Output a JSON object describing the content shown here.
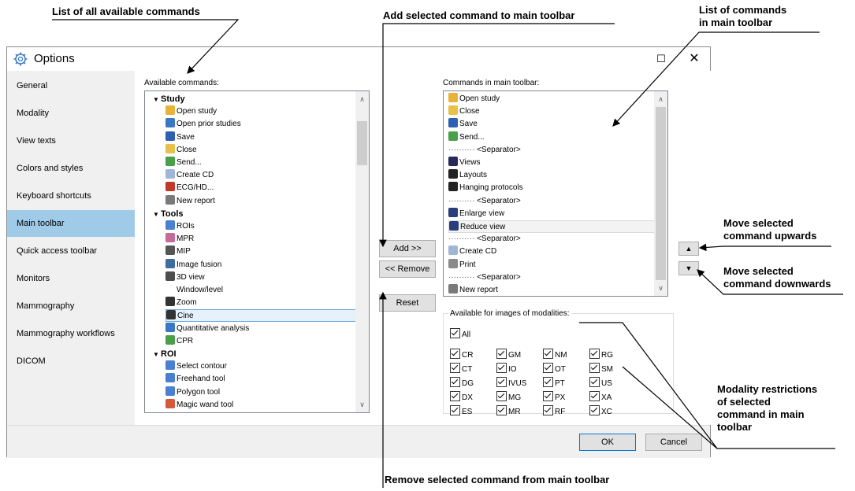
{
  "annotations": {
    "all_commands": "List of all available commands",
    "add_selected": "Add selected command to main toolbar",
    "list_main": "List of commands\nin main toolbar",
    "move_up": "Move selected\ncommand upwards",
    "move_down": "Move selected\ncommand downwards",
    "modality": "Modality restrictions\nof selected\ncommand in main\ntoolbar",
    "remove_selected": "Remove selected command from main toolbar"
  },
  "dialog": {
    "title": "Options",
    "maximize": "☐",
    "close": "✕"
  },
  "sidebar": {
    "items": [
      {
        "label": "General"
      },
      {
        "label": "Modality"
      },
      {
        "label": "View texts"
      },
      {
        "label": "Colors and styles"
      },
      {
        "label": "Keyboard shortcuts"
      },
      {
        "label": "Main toolbar",
        "selected": true
      },
      {
        "label": "Quick access toolbar"
      },
      {
        "label": "Monitors"
      },
      {
        "label": "Mammography"
      },
      {
        "label": "Mammography workflows"
      },
      {
        "label": "DICOM"
      }
    ]
  },
  "available": {
    "label": "Available commands:",
    "rows": [
      {
        "text": "Study",
        "group": true
      },
      {
        "text": "Open study",
        "icon": "folder-open-icon",
        "color": "#e8b33a"
      },
      {
        "text": "Open prior studies",
        "icon": "prior-studies-icon",
        "color": "#3b78c4"
      },
      {
        "text": "Save",
        "icon": "save-icon",
        "color": "#2f5fb3"
      },
      {
        "text": "Close",
        "icon": "folder-icon",
        "color": "#e8c04a"
      },
      {
        "text": "Send...",
        "icon": "send-icon",
        "color": "#4aa04a"
      },
      {
        "text": "Create CD",
        "icon": "cd-icon",
        "color": "#9fb6d6"
      },
      {
        "text": "ECG/HD...",
        "icon": "ecg-icon",
        "color": "#c0392b"
      },
      {
        "text": "New report",
        "icon": "report-icon",
        "color": "#7a7a7a"
      },
      {
        "text": "Tools",
        "group": true
      },
      {
        "text": "ROIs",
        "icon": "roi-icon",
        "color": "#4a7fd1"
      },
      {
        "text": "MPR",
        "icon": "mpr-icon",
        "color": "#c46b9a"
      },
      {
        "text": "MIP",
        "icon": "mip-icon",
        "color": "#555555"
      },
      {
        "text": "Image fusion",
        "icon": "fusion-icon",
        "color": "#3d6e9e"
      },
      {
        "text": "3D view",
        "icon": "cube-icon",
        "color": "#4d4d4d"
      },
      {
        "text": "Window/level",
        "icon": "",
        "color": ""
      },
      {
        "text": "Zoom",
        "icon": "magnifier-icon",
        "color": "#333333"
      },
      {
        "text": "Cine",
        "icon": "cine-icon",
        "color": "#333333",
        "selected": true
      },
      {
        "text": "Quantitative analysis",
        "icon": "chart-icon",
        "color": "#3b78c4"
      },
      {
        "text": "CPR",
        "icon": "cpr-icon",
        "color": "#4aa04a"
      },
      {
        "text": "ROI",
        "group": true
      },
      {
        "text": "Select contour",
        "icon": "select-contour-icon",
        "color": "#4a7fd1"
      },
      {
        "text": "Freehand tool",
        "icon": "freehand-icon",
        "color": "#4a7fd1"
      },
      {
        "text": "Polygon tool",
        "icon": "polygon-icon",
        "color": "#4a7fd1"
      },
      {
        "text": "Magic wand tool",
        "icon": "magic-wand-icon",
        "color": "#d65a3a"
      }
    ]
  },
  "main_toolbar": {
    "label": "Commands in main toolbar:",
    "rows": [
      {
        "text": "Open study",
        "icon": "folder-open-icon",
        "color": "#e8b33a"
      },
      {
        "text": "Close",
        "icon": "folder-icon",
        "color": "#e8c04a"
      },
      {
        "text": "Save",
        "icon": "save-icon",
        "color": "#2f5fb3"
      },
      {
        "text": "Send...",
        "icon": "send-icon",
        "color": "#4aa04a"
      },
      {
        "text": "<Separator>",
        "separator": true
      },
      {
        "text": "Views",
        "icon": "views-icon",
        "color": "#2a2a5a"
      },
      {
        "text": "Layouts",
        "icon": "layouts-icon",
        "color": "#222222"
      },
      {
        "text": "Hanging protocols",
        "icon": "hanging-protocols-icon",
        "color": "#222222"
      },
      {
        "text": "<Separator>",
        "separator": true
      },
      {
        "text": "Enlarge view",
        "icon": "enlarge-view-icon",
        "color": "#2a3f7a"
      },
      {
        "text": "Reduce view",
        "icon": "reduce-view-icon",
        "color": "#2a3f7a",
        "highlight": true
      },
      {
        "text": "<Separator>",
        "separator": true
      },
      {
        "text": "Create CD",
        "icon": "cd-icon",
        "color": "#9fb6d6"
      },
      {
        "text": "Print",
        "icon": "printer-icon",
        "color": "#8a8a8a"
      },
      {
        "text": "<Separator>",
        "separator": true
      },
      {
        "text": "New report",
        "icon": "report-icon",
        "color": "#7a7a7a"
      }
    ]
  },
  "buttons": {
    "add": "Add >>",
    "remove": "<< Remove",
    "reset": "Reset",
    "move_up": "▲",
    "move_down": "▼",
    "ok": "OK",
    "cancel": "Cancel"
  },
  "modalities": {
    "label": "Available for images of modalities:",
    "all": "All",
    "items": [
      "CR",
      "GM",
      "NM",
      "RG",
      "CT",
      "IO",
      "OT",
      "SM",
      "DG",
      "IVUS",
      "PT",
      "US",
      "DX",
      "MG",
      "PX",
      "XA",
      "ES",
      "MR",
      "RF",
      "XC"
    ]
  }
}
